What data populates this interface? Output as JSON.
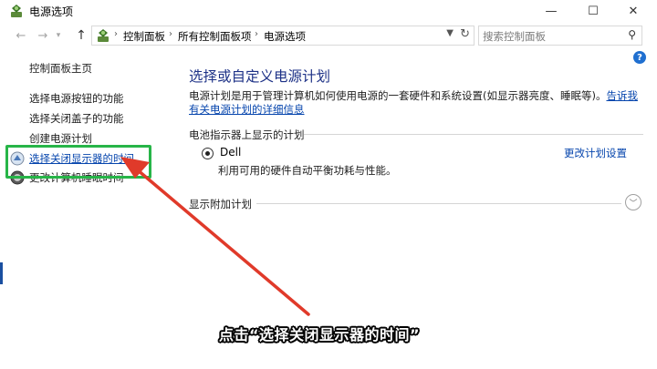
{
  "window": {
    "title": "电源选项",
    "minimize": "—",
    "maximize": "☐",
    "close": "✕"
  },
  "address": {
    "crumbs": [
      "控制面板",
      "所有控制面板项",
      "电源选项"
    ],
    "search_placeholder": "搜索控制面板"
  },
  "sidebar": {
    "home": "控制面板主页",
    "items": [
      "选择电源按钮的功能",
      "选择关闭盖子的功能",
      "创建电源计划",
      "选择关闭显示器的时间",
      "更改计算机睡眠时间"
    ]
  },
  "main": {
    "title": "选择或自定义电源计划",
    "desc_text": "电源计划是用于管理计算机如何使用电源的一套硬件和系统设置(如显示器亮度、睡眠等)。",
    "desc_link": "告诉我有关电源计划的详细信息",
    "battery_section": "电池指示器上显示的计划",
    "plan": {
      "name": "Dell",
      "description": "利用可用的硬件自动平衡功耗与性能。",
      "change_link": "更改计划设置"
    },
    "extra_section": "显示附加计划"
  },
  "caption": "点击“选择关闭显示器的时间”",
  "colors": {
    "title_blue": "#1e3287",
    "link_blue": "#0645ad",
    "highlight_green": "#27b548",
    "arrow_red": "#e03a2a"
  }
}
